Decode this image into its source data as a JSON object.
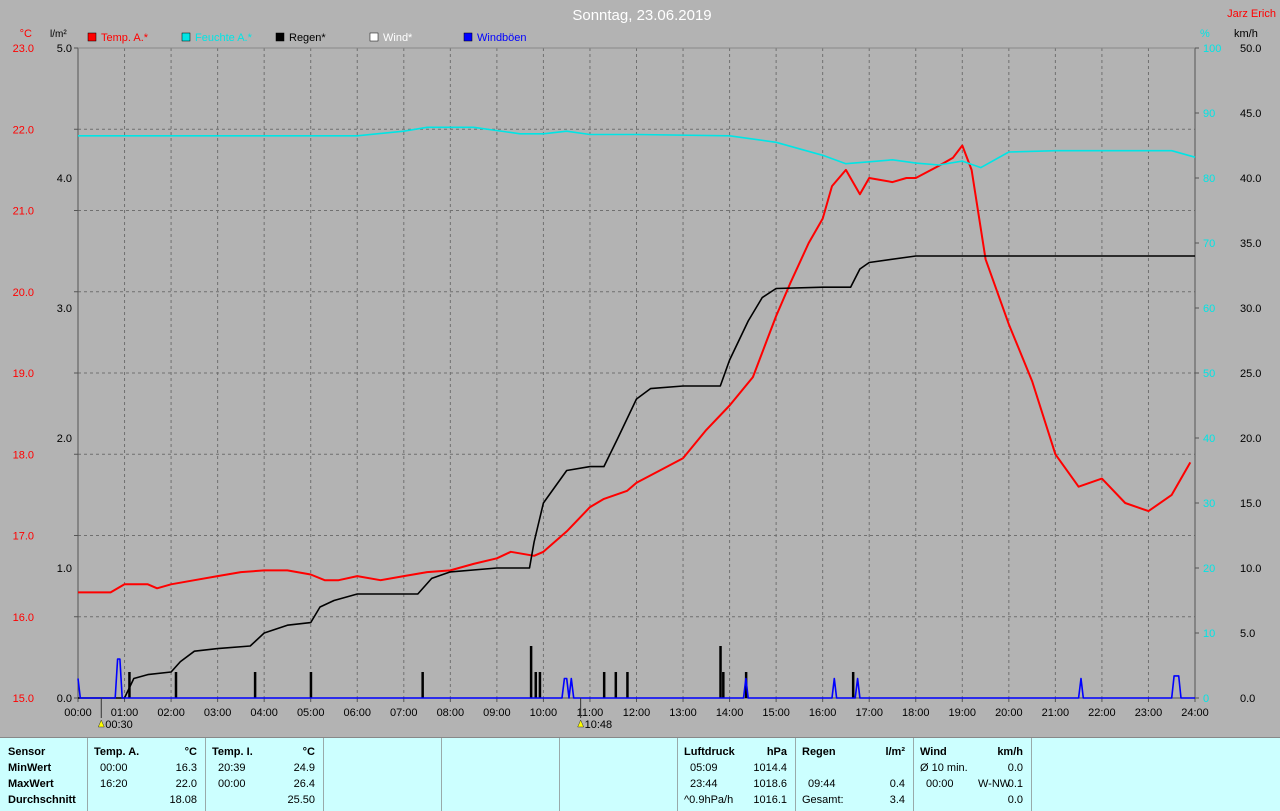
{
  "title": "Sonntag, 23.06.2019",
  "author": "Jarz Erich",
  "units": {
    "temp": "°C",
    "rain": "l/m²",
    "humidity": "%",
    "wind": "km/h"
  },
  "legend": [
    {
      "label": "Temp. A.*",
      "color": "#ff0000"
    },
    {
      "label": "Feuchte A.*",
      "color": "#00e5e5"
    },
    {
      "label": "Regen*",
      "color": "#000000"
    },
    {
      "label": "Wind*",
      "color": "#ffffff"
    },
    {
      "label": "Windböen",
      "color": "#0000ff"
    }
  ],
  "markers": [
    {
      "label": "00:30",
      "hour": 0.5
    },
    {
      "label": "10:48",
      "hour": 10.8
    }
  ],
  "chart_data": {
    "type": "line",
    "title": "Sonntag, 23.06.2019",
    "grid": true,
    "x": {
      "range": [
        0,
        24
      ],
      "ticks": [
        "00:00",
        "01:00",
        "02:00",
        "03:00",
        "04:00",
        "05:00",
        "06:00",
        "07:00",
        "08:00",
        "09:00",
        "10:00",
        "11:00",
        "12:00",
        "13:00",
        "14:00",
        "15:00",
        "16:00",
        "17:00",
        "18:00",
        "19:00",
        "20:00",
        "21:00",
        "22:00",
        "23:00",
        "24:00"
      ]
    },
    "axes": {
      "temp": {
        "range": [
          15,
          23
        ],
        "ticks": [
          "15.0",
          "16.0",
          "17.0",
          "18.0",
          "19.0",
          "20.0",
          "21.0",
          "22.0",
          "23.0"
        ]
      },
      "rain": {
        "range": [
          0,
          5
        ],
        "ticks": [
          "0.0",
          "1.0",
          "2.0",
          "3.0",
          "4.0",
          "5.0"
        ]
      },
      "humidity": {
        "range": [
          0,
          100
        ],
        "ticks": [
          "0",
          "10",
          "20",
          "30",
          "40",
          "50",
          "60",
          "70",
          "80",
          "90",
          "100"
        ]
      },
      "wind": {
        "range": [
          0,
          50
        ],
        "ticks": [
          "0.0",
          "5.0",
          "10.0",
          "15.0",
          "20.0",
          "25.0",
          "30.0",
          "35.0",
          "40.0",
          "45.0",
          "50.0"
        ]
      }
    },
    "series": [
      {
        "name": "Temp. A.*",
        "axis": "temp",
        "color": "#ff0000",
        "points": [
          [
            0,
            16.3
          ],
          [
            0.7,
            16.3
          ],
          [
            1,
            16.4
          ],
          [
            1.5,
            16.4
          ],
          [
            1.7,
            16.35
          ],
          [
            2,
            16.4
          ],
          [
            2.5,
            16.45
          ],
          [
            3,
            16.5
          ],
          [
            3.5,
            16.55
          ],
          [
            4,
            16.57
          ],
          [
            4.5,
            16.57
          ],
          [
            5,
            16.52
          ],
          [
            5.3,
            16.45
          ],
          [
            5.6,
            16.45
          ],
          [
            6,
            16.5
          ],
          [
            6.5,
            16.45
          ],
          [
            7,
            16.5
          ],
          [
            7.5,
            16.55
          ],
          [
            8,
            16.57
          ],
          [
            8.5,
            16.65
          ],
          [
            9,
            16.72
          ],
          [
            9.3,
            16.8
          ],
          [
            9.8,
            16.75
          ],
          [
            10,
            16.8
          ],
          [
            10.5,
            17.05
          ],
          [
            11,
            17.35
          ],
          [
            11.3,
            17.45
          ],
          [
            11.8,
            17.55
          ],
          [
            12,
            17.65
          ],
          [
            12.5,
            17.8
          ],
          [
            13,
            17.95
          ],
          [
            13.5,
            18.3
          ],
          [
            14,
            18.6
          ],
          [
            14.5,
            18.95
          ],
          [
            14.8,
            19.4
          ],
          [
            15,
            19.7
          ],
          [
            15.3,
            20.1
          ],
          [
            15.7,
            20.6
          ],
          [
            16,
            20.9
          ],
          [
            16.2,
            21.3
          ],
          [
            16.5,
            21.5
          ],
          [
            16.8,
            21.2
          ],
          [
            17,
            21.4
          ],
          [
            17.5,
            21.35
          ],
          [
            17.8,
            21.4
          ],
          [
            18,
            21.4
          ],
          [
            18.5,
            21.55
          ],
          [
            18.8,
            21.65
          ],
          [
            19,
            21.8
          ],
          [
            19.2,
            21.5
          ],
          [
            19.5,
            20.4
          ],
          [
            20,
            19.6
          ],
          [
            20.5,
            18.9
          ],
          [
            21,
            18.0
          ],
          [
            21.5,
            17.6
          ],
          [
            22,
            17.7
          ],
          [
            22.5,
            17.4
          ],
          [
            23,
            17.3
          ],
          [
            23.5,
            17.5
          ],
          [
            23.9,
            17.9
          ]
        ]
      },
      {
        "name": "Feuchte A.*",
        "axis": "humidity",
        "color": "#00e5e5",
        "points": [
          [
            0,
            86.5
          ],
          [
            2,
            86.5
          ],
          [
            4,
            86.5
          ],
          [
            6,
            86.5
          ],
          [
            7,
            87.2
          ],
          [
            7.5,
            87.8
          ],
          [
            8.5,
            87.8
          ],
          [
            9.5,
            86.8
          ],
          [
            10,
            86.8
          ],
          [
            10.5,
            87.2
          ],
          [
            11,
            86.7
          ],
          [
            12,
            86.7
          ],
          [
            14,
            86.5
          ],
          [
            15,
            85.5
          ],
          [
            16,
            83.5
          ],
          [
            16.5,
            82.2
          ],
          [
            17,
            82.5
          ],
          [
            17.5,
            82.8
          ],
          [
            18,
            82.3
          ],
          [
            18.5,
            82.0
          ],
          [
            19,
            82.6
          ],
          [
            19.4,
            81.6
          ],
          [
            20,
            84.0
          ],
          [
            21,
            84.2
          ],
          [
            22,
            84.2
          ],
          [
            23.5,
            84.2
          ],
          [
            24,
            83.2
          ]
        ]
      },
      {
        "name": "Regen*",
        "axis": "rain",
        "color": "#000000",
        "points": [
          [
            0,
            0
          ],
          [
            1,
            0
          ],
          [
            1.2,
            0.15
          ],
          [
            1.5,
            0.18
          ],
          [
            2,
            0.2
          ],
          [
            2.2,
            0.28
          ],
          [
            2.5,
            0.36
          ],
          [
            3,
            0.38
          ],
          [
            3.7,
            0.4
          ],
          [
            4,
            0.5
          ],
          [
            4.5,
            0.56
          ],
          [
            5,
            0.58
          ],
          [
            5.2,
            0.7
          ],
          [
            5.5,
            0.75
          ],
          [
            6,
            0.8
          ],
          [
            7,
            0.8
          ],
          [
            7.3,
            0.8
          ],
          [
            7.6,
            0.92
          ],
          [
            8,
            0.97
          ],
          [
            9,
            1.0
          ],
          [
            9.7,
            1.0
          ],
          [
            9.8,
            1.2
          ],
          [
            10,
            1.5
          ],
          [
            10.5,
            1.75
          ],
          [
            11,
            1.78
          ],
          [
            11.3,
            1.78
          ],
          [
            11.6,
            2.0
          ],
          [
            12,
            2.3
          ],
          [
            12.3,
            2.38
          ],
          [
            13,
            2.4
          ],
          [
            13.8,
            2.4
          ],
          [
            14,
            2.6
          ],
          [
            14.4,
            2.9
          ],
          [
            14.7,
            3.08
          ],
          [
            15,
            3.15
          ],
          [
            16,
            3.16
          ],
          [
            16.6,
            3.16
          ],
          [
            16.8,
            3.3
          ],
          [
            17,
            3.35
          ],
          [
            18,
            3.4
          ],
          [
            24,
            3.4
          ]
        ]
      },
      {
        "name": "Windböen",
        "axis": "wind",
        "color": "#0000ff",
        "points": [
          [
            0,
            1.5
          ],
          [
            0.05,
            0
          ],
          [
            0.8,
            0
          ],
          [
            0.85,
            3
          ],
          [
            0.9,
            3
          ],
          [
            0.95,
            0
          ],
          [
            10.4,
            0
          ],
          [
            10.45,
            1.5
          ],
          [
            10.5,
            1.5
          ],
          [
            10.55,
            0
          ],
          [
            10.6,
            1.5
          ],
          [
            10.65,
            0
          ],
          [
            14.3,
            0
          ],
          [
            14.35,
            1.5
          ],
          [
            14.4,
            0
          ],
          [
            16.2,
            0
          ],
          [
            16.25,
            1.5
          ],
          [
            16.3,
            0
          ],
          [
            16.7,
            0
          ],
          [
            16.75,
            1.5
          ],
          [
            16.8,
            0
          ],
          [
            21.5,
            0
          ],
          [
            21.55,
            1.5
          ],
          [
            21.6,
            0
          ],
          [
            23.5,
            0
          ],
          [
            23.55,
            1.7
          ],
          [
            23.65,
            1.7
          ],
          [
            23.7,
            0
          ],
          [
            24,
            0
          ]
        ]
      }
    ],
    "rain_bars": [
      {
        "hour": 1.1,
        "value": 0.2
      },
      {
        "hour": 2.1,
        "value": 0.2
      },
      {
        "hour": 3.8,
        "value": 0.2
      },
      {
        "hour": 5.0,
        "value": 0.2
      },
      {
        "hour": 7.4,
        "value": 0.2
      },
      {
        "hour": 9.73,
        "value": 0.4
      },
      {
        "hour": 9.83,
        "value": 0.2
      },
      {
        "hour": 9.92,
        "value": 0.2
      },
      {
        "hour": 11.3,
        "value": 0.2
      },
      {
        "hour": 11.55,
        "value": 0.2
      },
      {
        "hour": 11.8,
        "value": 0.2
      },
      {
        "hour": 13.8,
        "value": 0.4
      },
      {
        "hour": 13.86,
        "value": 0.2
      },
      {
        "hour": 14.35,
        "value": 0.2
      },
      {
        "hour": 16.65,
        "value": 0.2
      }
    ]
  },
  "table": {
    "row_labels": [
      "Sensor",
      "MinWert",
      "MaxWert",
      "Durchschnitt"
    ],
    "temp_a": {
      "header": "Temp. A.",
      "unit": "°C",
      "min_time": "00:00",
      "min": "16.3",
      "max_time": "16:20",
      "max": "22.0",
      "avg": "18.08"
    },
    "temp_i": {
      "header": "Temp. I.",
      "unit": "°C",
      "min_time": "20:39",
      "min": "24.9",
      "max_time": "00:00",
      "max": "26.4",
      "avg": "25.50"
    },
    "pressure": {
      "header": "Luftdruck",
      "unit": "hPa",
      "min_time": "05:09",
      "min": "1014.4",
      "max_time": "23:44",
      "max": "1018.6",
      "trend": "^0.9hPa/h",
      "current": "1016.1"
    },
    "rain": {
      "header": "Regen",
      "unit": "l/m²",
      "max_time": "09:44",
      "max": "0.4",
      "total_label": "Gesamt:",
      "total": "3.4"
    },
    "wind": {
      "header": "Wind",
      "unit": "km/h",
      "avg_label": "Ø 10 min.",
      "avg": "0.0",
      "max_time": "00:00",
      "dir": "W-NW",
      "max": "0.1",
      "last": "0.0"
    }
  }
}
